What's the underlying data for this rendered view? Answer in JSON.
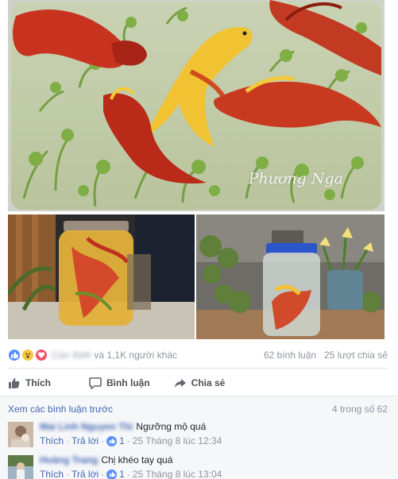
{
  "photos": {
    "watermark": "Phương Nga"
  },
  "stats": {
    "reaction_icons": [
      "like-icon",
      "wow-icon",
      "love-icon"
    ],
    "reactor_name": "Cún Xinh",
    "others_text": "và 1,1K người khác",
    "comments_count": "62 bình luận",
    "shares_count": "25 lượt chia sẻ"
  },
  "actions": {
    "like": "Thích",
    "comment": "Bình luận",
    "share": "Chia sẻ"
  },
  "comments": {
    "view_previous": "Xem các bình luận trước",
    "count_text": "4 trong số 62",
    "items": [
      {
        "name": "Mai Linh Nguyen Thi",
        "text": "Ngưỡng mộ quá",
        "like": "Thích",
        "reply": "Trả lời",
        "likes": "1",
        "time": "25 Tháng 8 lúc 12:34"
      },
      {
        "name": "Hoàng Trang",
        "text": "Chị khéo tay quá",
        "like": "Thích",
        "reply": "Trả lời",
        "likes": "1",
        "time": "25 Tháng 8 lúc 13:04"
      }
    ]
  },
  "colors": {
    "link": "#4267b2",
    "muted": "#90949c",
    "like_blue": "#5890ff"
  }
}
